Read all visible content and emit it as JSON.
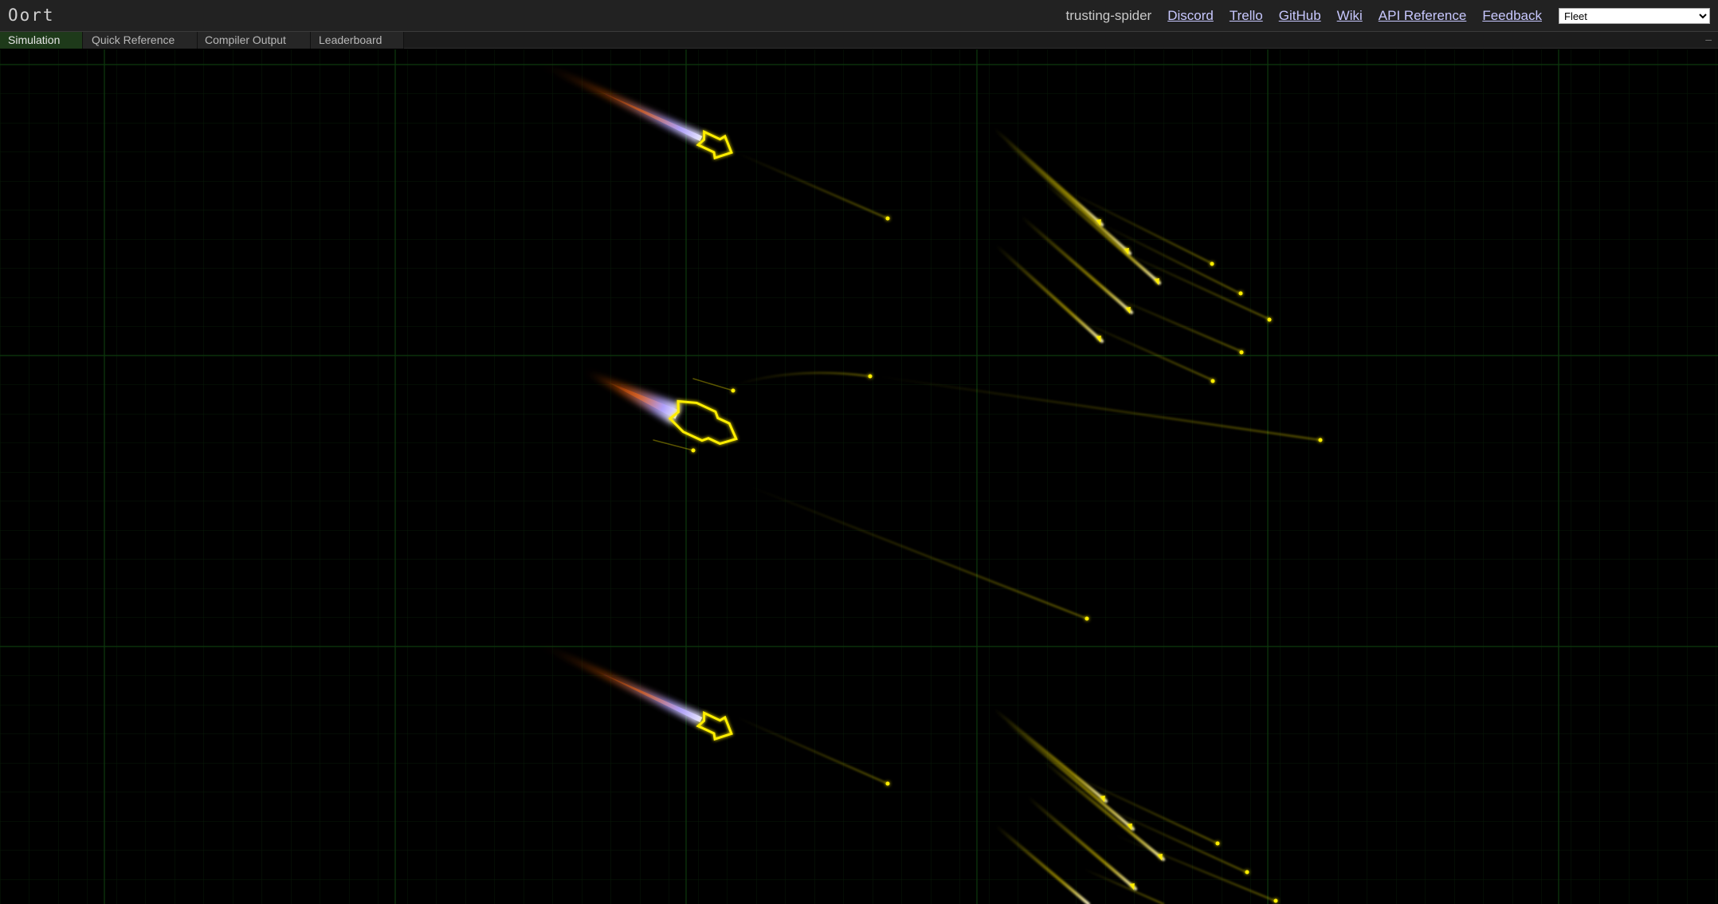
{
  "app": {
    "title": "Oort",
    "username": "trusting-spider"
  },
  "nav": {
    "links": [
      "Discord",
      "Trello",
      "GitHub",
      "Wiki",
      "API Reference",
      "Feedback"
    ],
    "scenario_select": {
      "selected": "Fleet"
    }
  },
  "tabs": [
    {
      "label": "Simulation",
      "active": true
    },
    {
      "label": "Quick Reference",
      "active": false
    },
    {
      "label": "Compiler Output",
      "active": false
    },
    {
      "label": "Leaderboard",
      "active": false
    }
  ],
  "colors": {
    "ship": "#ffee00",
    "grid_major": "#0d3a0d",
    "grid_minor": "#071a07",
    "exhaust_core": "#c8c8ff",
    "exhaust_tail": "#ff6a10",
    "active_tab": "#1e3a1a",
    "topbar": "#222222",
    "link": "#c8c8ff"
  },
  "icons": {
    "collapse": "collapse-icon"
  }
}
